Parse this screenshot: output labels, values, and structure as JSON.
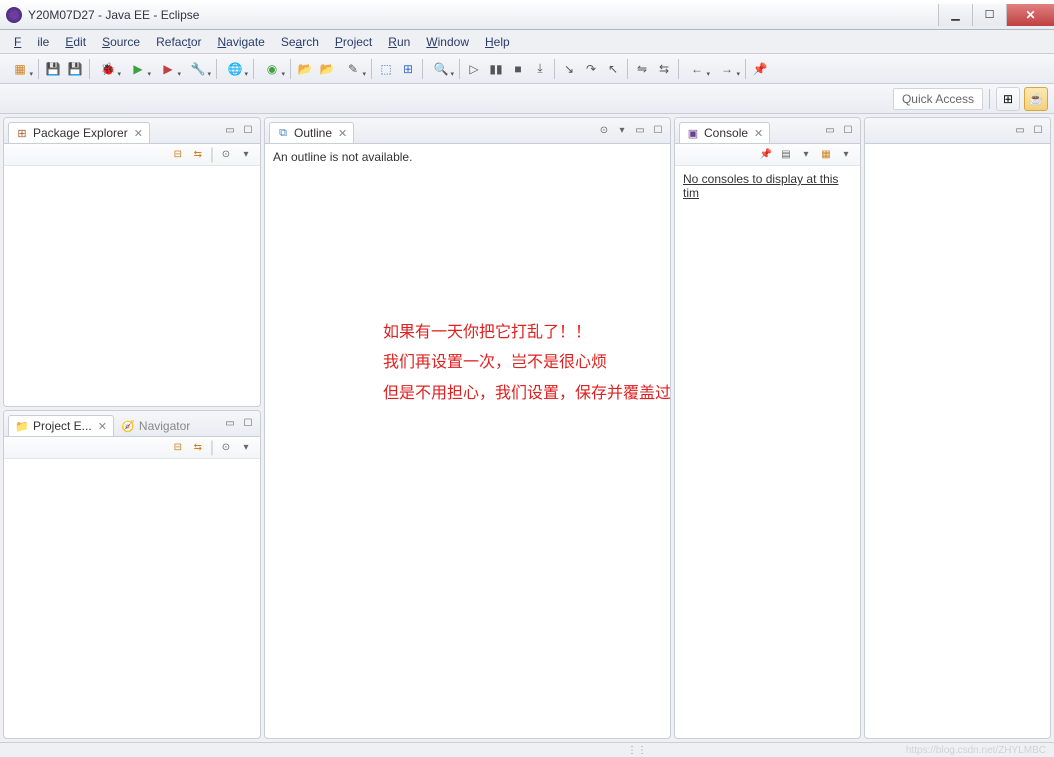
{
  "window": {
    "title": "Y20M07D27 - Java EE - Eclipse"
  },
  "menu": {
    "file": "File",
    "edit": "Edit",
    "source": "Source",
    "refactor": "Refactor",
    "navigate": "Navigate",
    "search": "Search",
    "project": "Project",
    "run": "Run",
    "window": "Window",
    "help": "Help"
  },
  "perspective": {
    "quick_access": "Quick Access"
  },
  "views": {
    "package_explorer": {
      "title": "Package Explorer"
    },
    "project_explorer": {
      "title": "Project E..."
    },
    "navigator": {
      "title": "Navigator"
    },
    "outline": {
      "title": "Outline",
      "empty_text": "An outline is not available."
    },
    "console": {
      "title": "Console",
      "empty_text": "No consoles to display at this tim"
    }
  },
  "annotation": {
    "line1": "如果有一天你把它打乱了！！",
    "line2": "我们再设置一次，岂不是很心烦",
    "line3": "但是不用担心，我们设置，保存并覆盖过原有的Java EE透视图了！"
  },
  "watermark": "https://blog.csdn.net/ZHYLMBC"
}
